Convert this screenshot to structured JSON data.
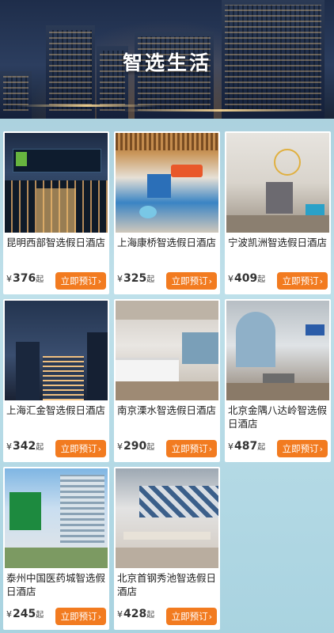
{
  "banner": {
    "title": "智选生活"
  },
  "hotels": [
    {
      "name": "昆明西部智选假日酒店",
      "price": "376",
      "button": "立即预订"
    },
    {
      "name": "上海康桥智选假日酒店",
      "price": "325",
      "button": "立即预订"
    },
    {
      "name": "宁波凯洲智选假日酒店",
      "price": "409",
      "button": "立即预订"
    },
    {
      "name": "上海汇金智选假日酒店",
      "price": "342",
      "button": "立即预订"
    },
    {
      "name": "南京溧水智选假日酒店",
      "price": "290",
      "button": "立即预订"
    },
    {
      "name": "北京金隅八达岭智选假日酒店",
      "price": "487",
      "button": "立即预订"
    },
    {
      "name": "泰州中国医药城智选假日酒店",
      "price": "245",
      "button": "立即预订"
    },
    {
      "name": "北京首钢秀池智选假日酒店",
      "price": "428",
      "button": "立即预订"
    }
  ],
  "labels": {
    "currency": "¥",
    "unit": "起",
    "chevron": "›"
  },
  "colors": {
    "accent": "#f27b20",
    "background": "#a9d3e0"
  }
}
